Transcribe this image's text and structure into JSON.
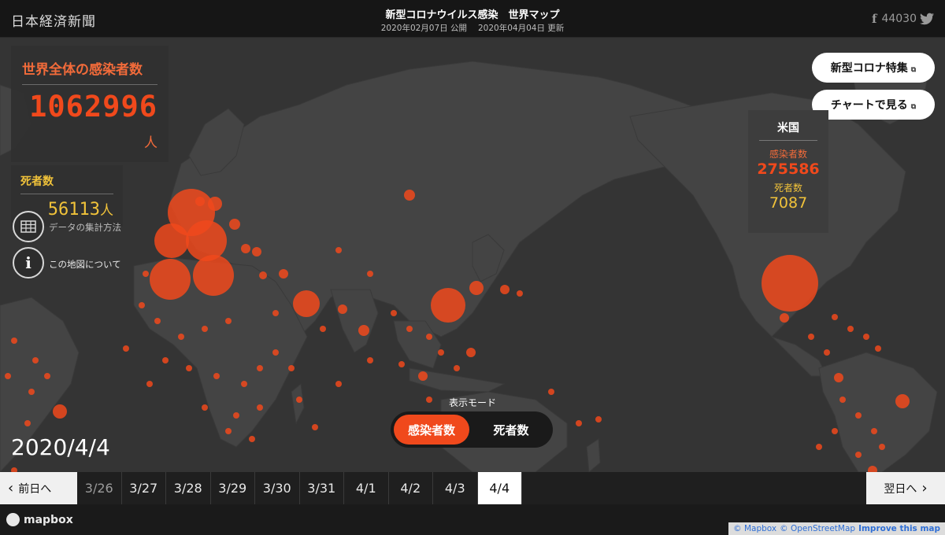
{
  "header": {
    "logo": "日本経済新聞",
    "title": "新型コロナウイルス感染　世界マップ",
    "published": "2020年02月07日 公開",
    "updated": "2020年04月04日 更新",
    "share_count": "44030",
    "facebook_icon": "facebook-icon",
    "twitter_icon": "twitter-icon"
  },
  "stats": {
    "infected_label": "世界全体の感染者数",
    "infected_value": "1062996",
    "infected_unit": "人",
    "deaths_label": "死者数",
    "deaths_value": "56113",
    "deaths_unit": "人"
  },
  "side_buttons": {
    "method_label": "データの集計方法",
    "about_label": "この地図について"
  },
  "links": {
    "feature": "新型コロナ特集",
    "chart": "チャートで見る"
  },
  "popup": {
    "country": "米国",
    "infected_label": "感染者数",
    "infected_value": "275586",
    "deaths_label": "死者数",
    "deaths_value": "7087"
  },
  "mode": {
    "label": "表示モード",
    "options": [
      "感染者数",
      "死者数"
    ],
    "selected": "感染者数"
  },
  "current_date": "2020/4/4",
  "datebar": {
    "prev_label": "前日へ",
    "next_label": "翌日へ",
    "dates": [
      "3/26",
      "3/27",
      "3/28",
      "3/29",
      "3/30",
      "3/31",
      "4/1",
      "4/2",
      "4/3",
      "4/4"
    ],
    "selected": "4/4"
  },
  "footer": {
    "mapbox": "mapbox",
    "attribution_mapbox": "© Mapbox",
    "attribution_osm": "© OpenStreetMap",
    "improve": "Improve this map"
  },
  "colors": {
    "accent": "#f0491c",
    "deaths": "#f0c23a",
    "land": "#444444",
    "sea": "#343434"
  }
}
